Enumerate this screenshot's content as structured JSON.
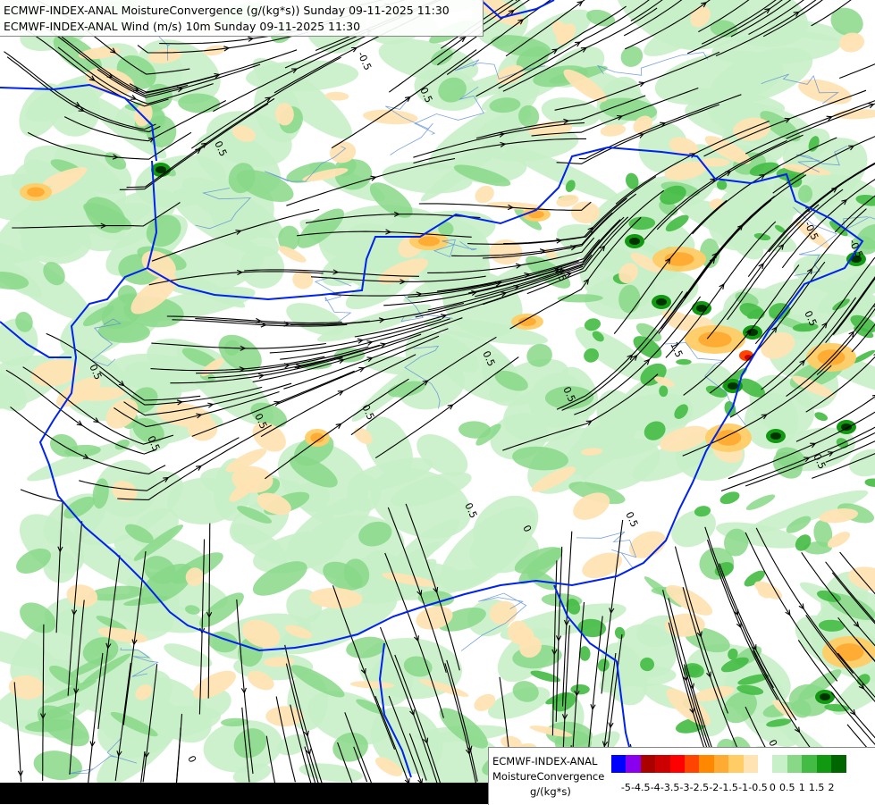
{
  "title_lines": [
    "ECMWF-INDEX-ANAL MoistureConvergence (g/(kg*s)) Sunday 09-11-2025 11:30",
    "ECMWF-INDEX-ANAL Wind (m/s) 10m Sunday 09-11-2025 11:30"
  ],
  "legend": {
    "lines": [
      "ECMWF-INDEX-ANAL",
      "MoistureConvergence",
      "g/(kg*s)"
    ],
    "colors": [
      "#0000ff",
      "#8800ee",
      "#aa0000",
      "#cc0000",
      "#ff0000",
      "#ff4400",
      "#ff8800",
      "#ffaa33",
      "#ffcc66",
      "#ffe3b3",
      "#ffffff",
      "#c8f0c8",
      "#88d888",
      "#44bb44",
      "#119911",
      "#006600"
    ],
    "ticks": [
      "-5",
      "-4.5",
      "-4",
      "-3.5",
      "-3",
      "-2.5",
      "-2",
      "-1.5",
      "-1",
      "-0.5",
      "0",
      "0.5",
      "1",
      "1.5",
      "2"
    ]
  },
  "contour_labels": [
    "0",
    "0.5",
    "-0.5",
    "1.5"
  ]
}
